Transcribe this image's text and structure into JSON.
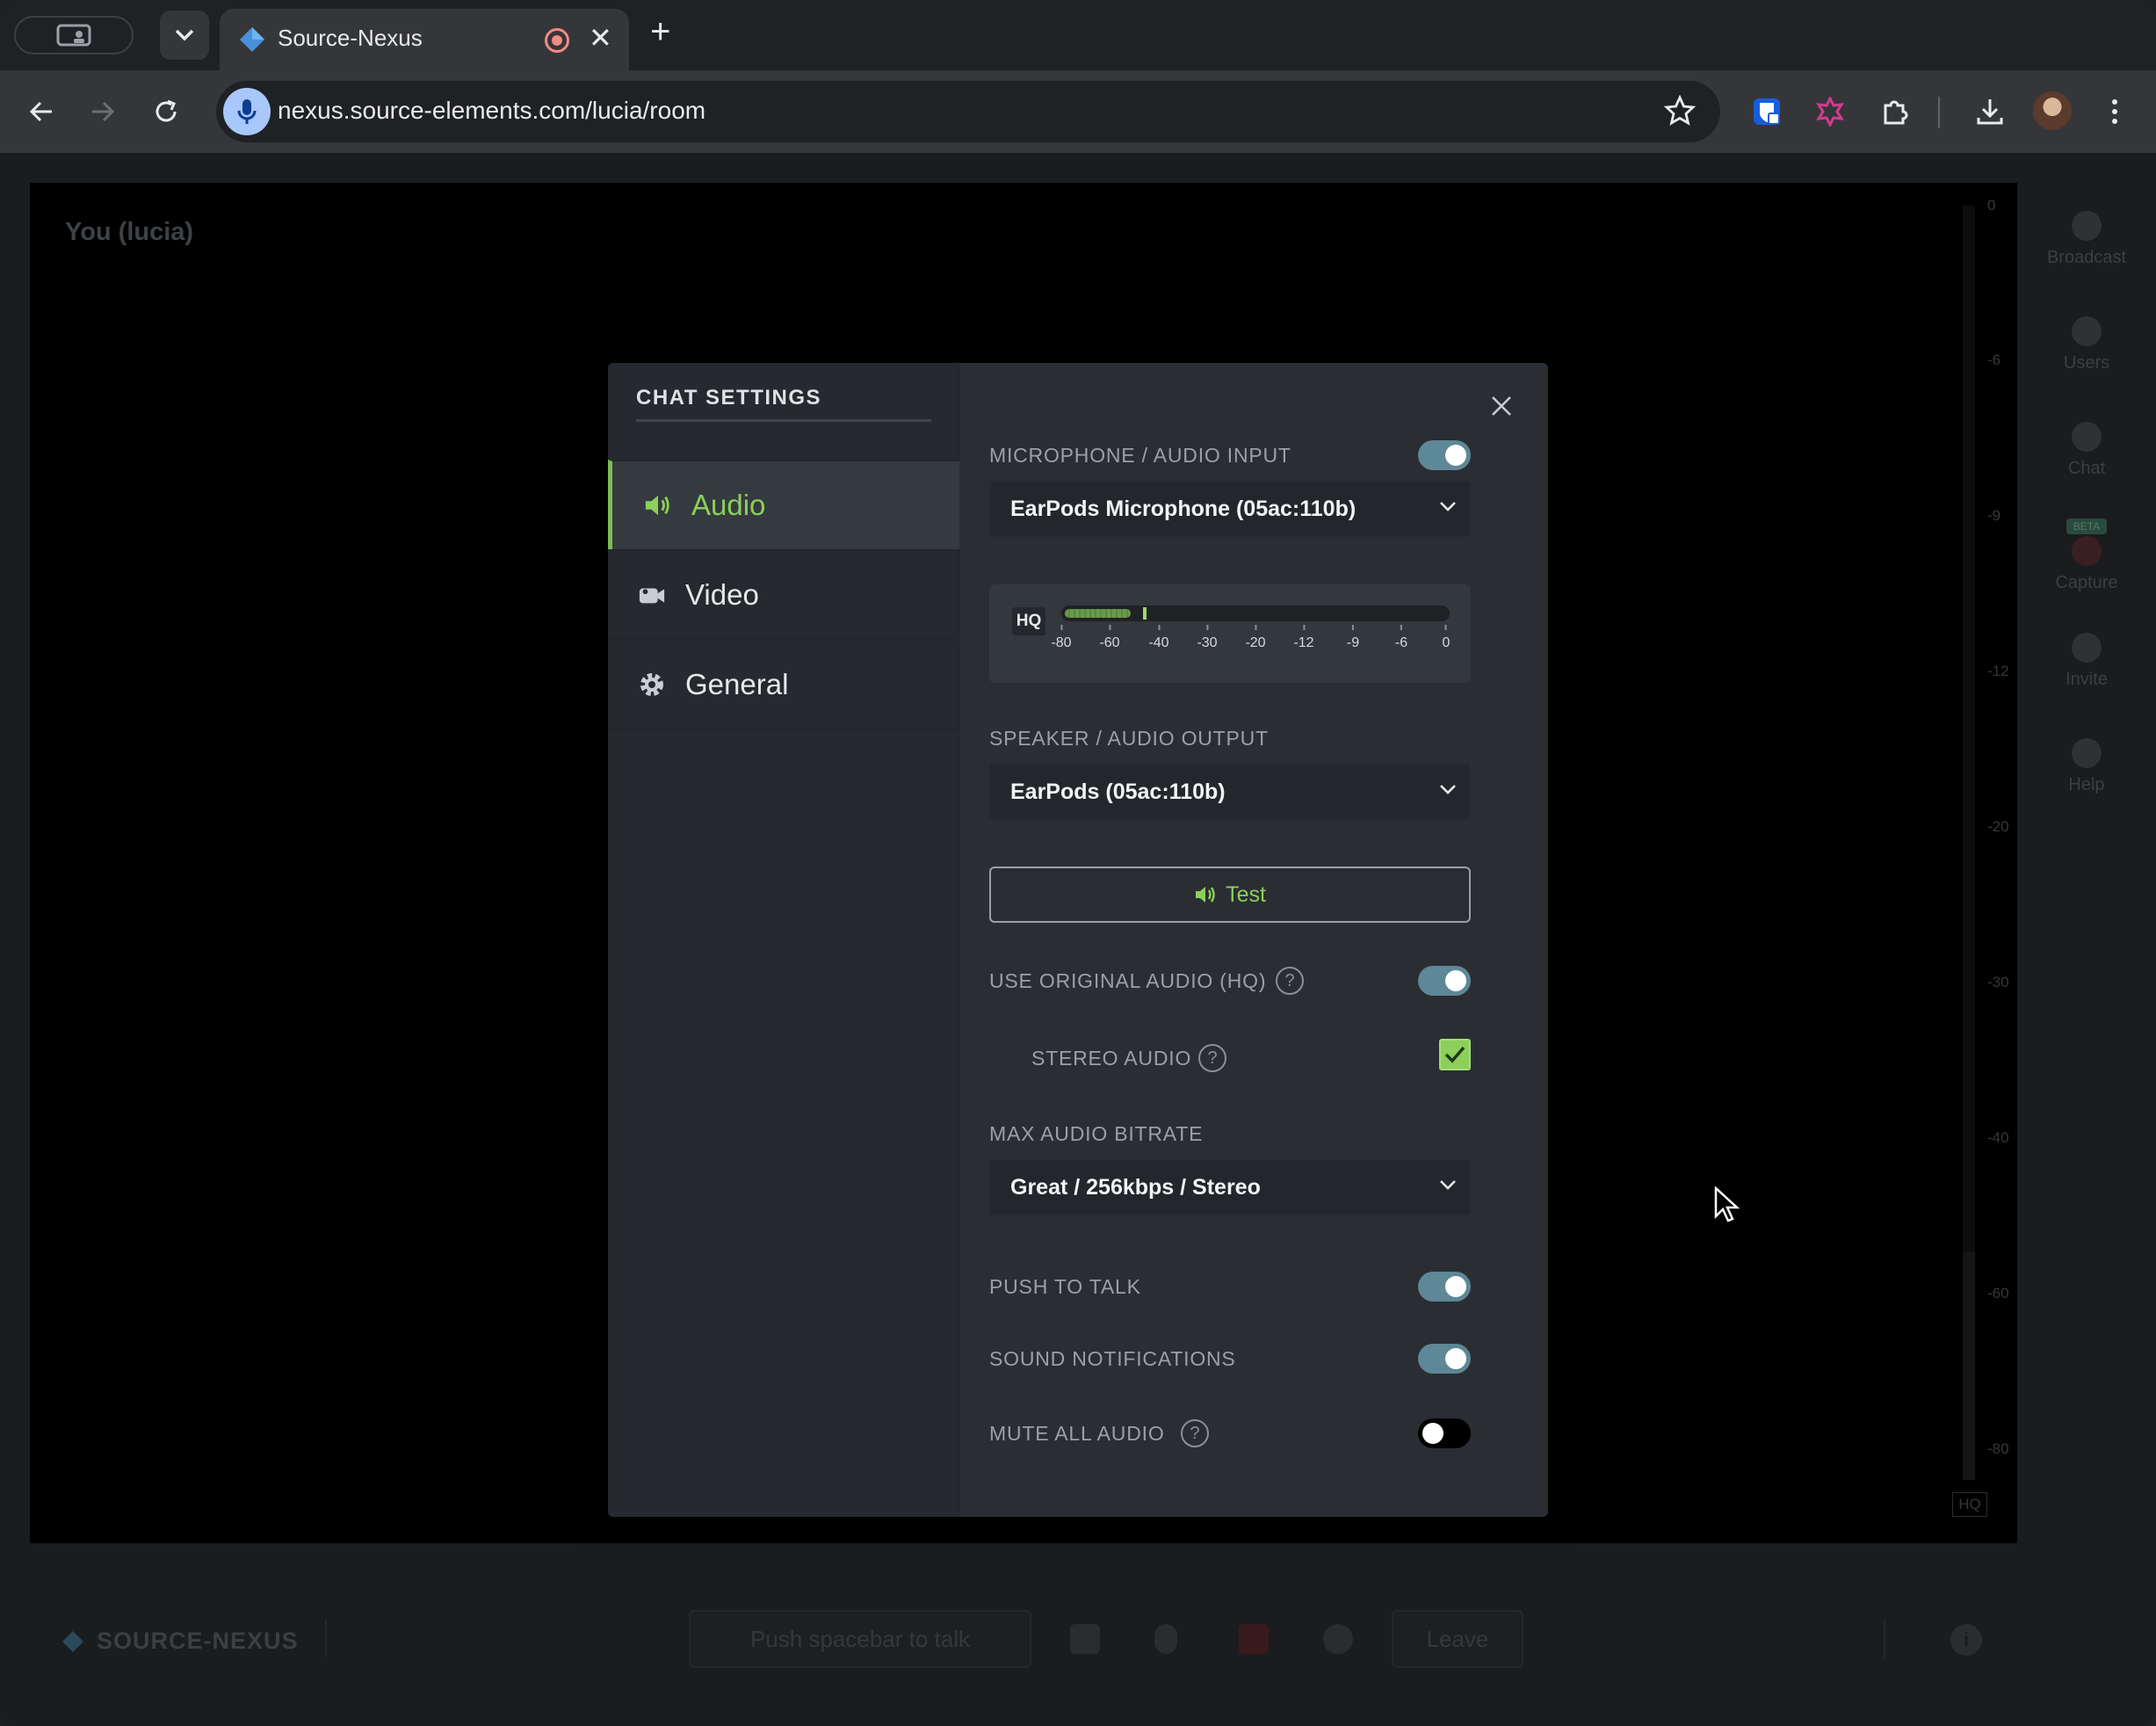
{
  "browser": {
    "tab_title": "Source-Nexus",
    "tab_close": "✕",
    "new_tab": "+",
    "url": "nexus.source-elements.com/lucia/room"
  },
  "video": {
    "you_label": "You (lucia)",
    "meter_ticks": [
      "0",
      "-6",
      "-9",
      "-12",
      "-20",
      "-30",
      "-40",
      "-60",
      "-80"
    ],
    "meter_hq": "HQ"
  },
  "right_nav": {
    "items": [
      {
        "label": "Broadcast",
        "icon": "broadcast-icon"
      },
      {
        "label": "Users",
        "icon": "users-icon"
      },
      {
        "label": "Chat",
        "icon": "chat-icon"
      },
      {
        "label": "Capture",
        "icon": "capture-icon",
        "badge": "BETA"
      },
      {
        "label": "Invite",
        "icon": "invite-icon"
      },
      {
        "label": "Help",
        "icon": "help-icon"
      }
    ]
  },
  "bottom_bar": {
    "brand": "SOURCE-NEXUS",
    "push_to_talk": "Push spacebar to talk",
    "leave": "Leave",
    "info": "i"
  },
  "settings": {
    "title": "CHAT SETTINGS",
    "nav": [
      {
        "label": "Audio",
        "icon": "speaker-icon",
        "active": true
      },
      {
        "label": "Video",
        "icon": "camera-icon",
        "active": false
      },
      {
        "label": "General",
        "icon": "gear-icon",
        "active": false
      }
    ],
    "mic_label": "MICROPHONE / AUDIO INPUT",
    "mic_enabled": true,
    "mic_device": "EarPods Microphone (05ac:110b)",
    "vu": {
      "hq": "HQ",
      "scale": [
        "-80",
        "-60",
        "-40",
        "-30",
        "-20",
        "-12",
        "-9",
        "-6",
        "0"
      ],
      "level_fraction": 0.17,
      "peak_fraction": 0.21
    },
    "speaker_label": "SPEAKER / AUDIO OUTPUT",
    "speaker_device": "EarPods (05ac:110b)",
    "test_label": "Test",
    "original_audio_label": "USE ORIGINAL AUDIO (HQ)",
    "original_audio_enabled": true,
    "stereo_label": "STEREO AUDIO",
    "stereo_checked": true,
    "bitrate_label": "MAX AUDIO BITRATE",
    "bitrate_value": "Great / 256kbps / Stereo",
    "push_to_talk_label": "PUSH TO TALK",
    "push_to_talk_enabled": true,
    "sound_notifications_label": "SOUND NOTIFICATIONS",
    "sound_notifications_enabled": true,
    "mute_all_label": "MUTE ALL AUDIO",
    "mute_all_enabled": false,
    "help_glyph": "?"
  },
  "colors": {
    "accent_green": "#8ccf5a",
    "toggle_on": "#5e8797",
    "modal_bg": "#2a2e32"
  }
}
